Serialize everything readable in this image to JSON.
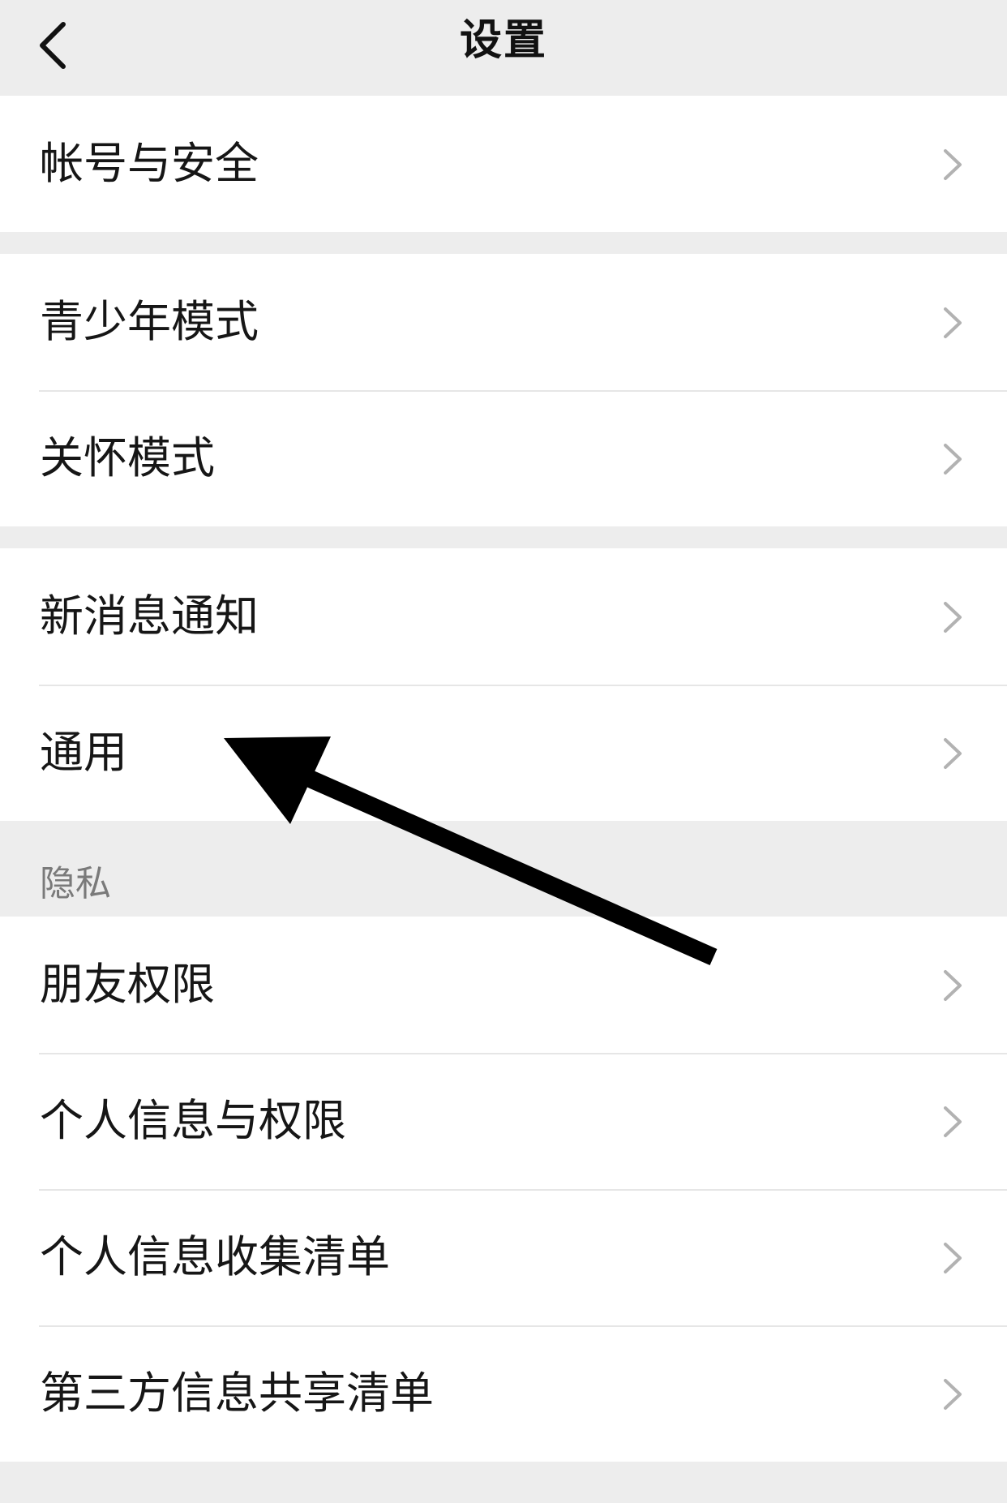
{
  "header": {
    "title": "设置"
  },
  "groups": [
    {
      "items": [
        {
          "label": "帐号与安全"
        }
      ]
    },
    {
      "items": [
        {
          "label": "青少年模式"
        },
        {
          "label": "关怀模式"
        }
      ]
    },
    {
      "items": [
        {
          "label": "新消息通知"
        },
        {
          "label": "通用"
        }
      ]
    },
    {
      "header": "隐私",
      "items": [
        {
          "label": "朋友权限"
        },
        {
          "label": "个人信息与权限"
        },
        {
          "label": "个人信息收集清单"
        },
        {
          "label": "第三方信息共享清单"
        }
      ]
    }
  ],
  "icons": {
    "back": "chevron-left-icon",
    "row_disclosure": "chevron-right-icon",
    "annotation": "arrow-pointer"
  },
  "colors": {
    "background": "#ededed",
    "cell_background": "#ffffff",
    "text_primary": "#161616",
    "text_secondary": "#7a7a7a",
    "chevron": "#b2b2b2",
    "divider": "#e6e6e6",
    "annotation_arrow": "#000000"
  }
}
